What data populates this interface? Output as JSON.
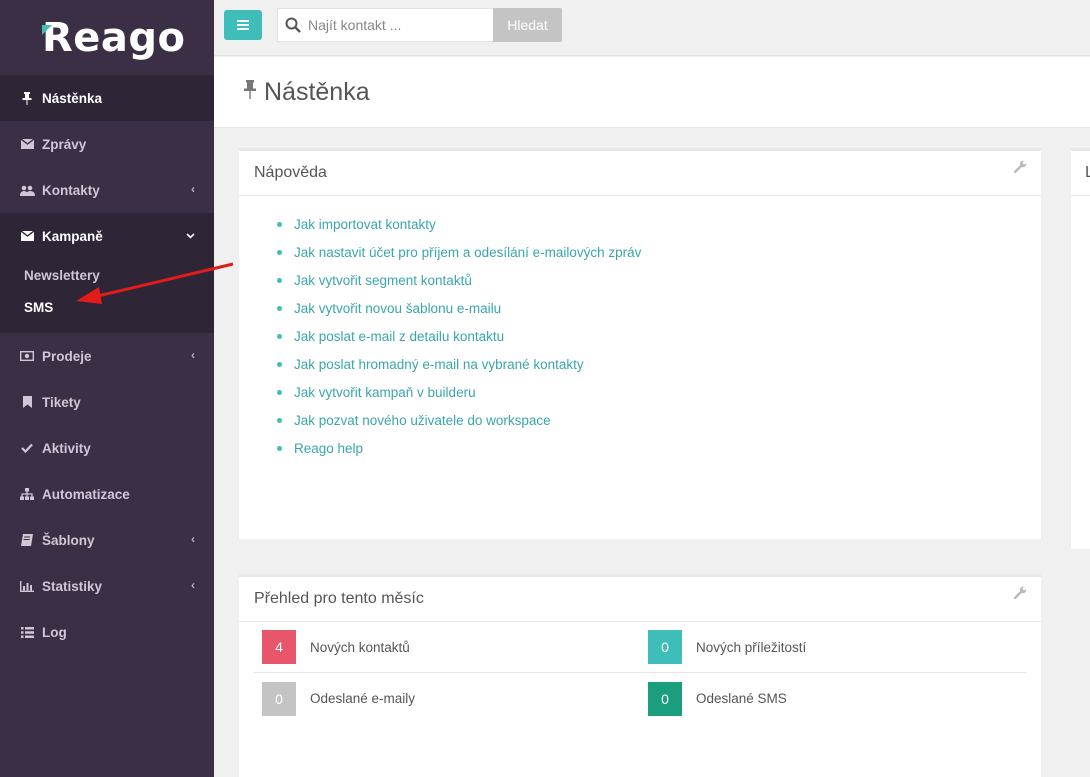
{
  "brand": {
    "logo_text": "Reago"
  },
  "topbar": {
    "search_placeholder": "Najít kontakt ...",
    "search_button": "Hledat"
  },
  "sidebar": {
    "items": [
      {
        "label": "Nástěnka",
        "icon": "pin-icon",
        "state": "active"
      },
      {
        "label": "Zprávy",
        "icon": "envelope-icon"
      },
      {
        "label": "Kontakty",
        "icon": "users-icon",
        "has_chevron": "left"
      },
      {
        "label": "Kampaně",
        "icon": "envelope-icon",
        "has_chevron": "down",
        "state": "open"
      },
      {
        "label": "Prodeje",
        "icon": "money-icon",
        "has_chevron": "left"
      },
      {
        "label": "Tikety",
        "icon": "bookmark-icon"
      },
      {
        "label": "Aktivity",
        "icon": "check-icon"
      },
      {
        "label": "Automatizace",
        "icon": "sitemap-icon"
      },
      {
        "label": "Šablony",
        "icon": "book-icon",
        "has_chevron": "left"
      },
      {
        "label": "Statistiky",
        "icon": "bar-chart-icon",
        "has_chevron": "left"
      },
      {
        "label": "Log",
        "icon": "list-icon"
      }
    ],
    "campaign_subitems": [
      {
        "label": "Newslettery"
      },
      {
        "label": "SMS"
      }
    ]
  },
  "page": {
    "title": "Nástěnka"
  },
  "help_panel": {
    "title": "Nápověda",
    "links": [
      "Jak importovat kontakty",
      "Jak nastavit účet pro příjem a odesílání e-mailových zpráv",
      "Jak vytvořit segment kontaktů",
      "Jak vytvořit novou šablonu e-mailu",
      "Jak poslat e-mail z detailu kontaktu",
      "Jak poslat hromadný e-mail na vybrané kontakty",
      "Jak vytvořit kampaň v builderu",
      "Jak pozvat nového uživatele do workspace",
      "Reago help"
    ]
  },
  "side_panel": {
    "title": "L"
  },
  "overview_panel": {
    "title": "Přehled pro tento měsíc",
    "stats": [
      {
        "value": "4",
        "label": "Nových kontaktů",
        "color": "#e8566b"
      },
      {
        "value": "0",
        "label": "Nových příležitostí",
        "color": "#3fbdb9"
      },
      {
        "value": "0",
        "label": "Odeslané e-maily",
        "color": "#c4c4c4"
      },
      {
        "value": "0",
        "label": "Odeslané SMS",
        "color": "#1a9e7d"
      }
    ]
  },
  "colors": {
    "sidebar_bg": "#3b2f45",
    "sidebar_active_bg": "#2e2537",
    "accent": "#3fbdb9",
    "link": "#3aa6ab",
    "annotation": "#e21b1b"
  }
}
